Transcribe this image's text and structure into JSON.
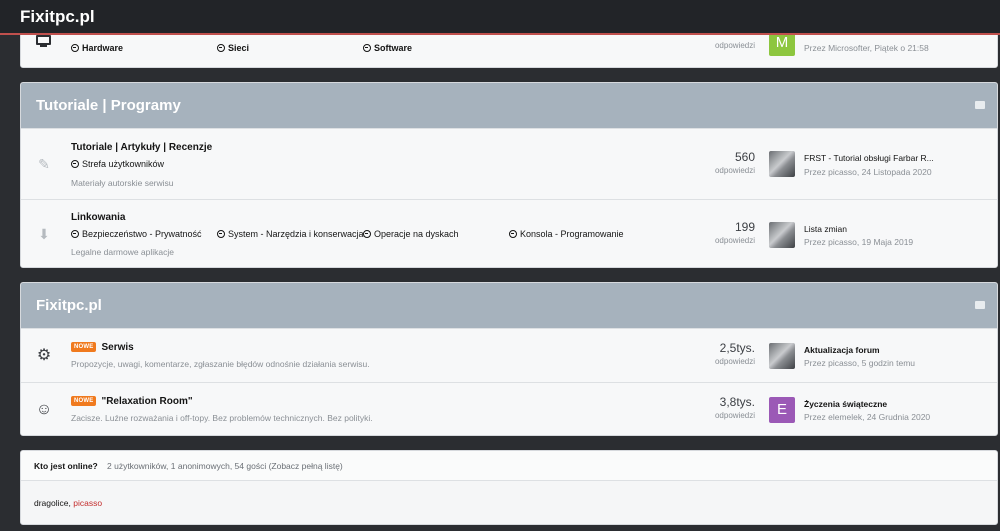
{
  "site": {
    "brand": "Fixitpc.pl"
  },
  "top_forum": {
    "sublinks": [
      "Hardware",
      "Sieci",
      "Software"
    ],
    "stat_label": "odpowiedzi",
    "last_author_line": "Przez Microsofter, Piątek o 21:58",
    "avatar_letter": "M",
    "avatar_color": "#8dc63f"
  },
  "sections": [
    {
      "title": "Tutoriale | Programy",
      "forums": [
        {
          "title": "Tutoriale | Artykuły | Recenzje",
          "sublinks": [
            "Strefa użytkowników"
          ],
          "description": "Materiały autorskie serwisu",
          "count": "560",
          "count_label": "odpowiedzi",
          "last_title": "FRST - Tutorial obsługi Farbar R...",
          "last_meta": "Przez picasso, 24 Listopada 2020"
        },
        {
          "title": "Linkowania",
          "sublinks": [
            "Bezpieczeństwo - Prywatność",
            "System - Narzędzia i konserwacja",
            "Operacje na dyskach",
            "Konsola - Programowanie"
          ],
          "description": "Legalne darmowe aplikacje",
          "count": "199",
          "count_label": "odpowiedzi",
          "last_title": "Lista zmian",
          "last_meta": "Przez picasso, 19 Maja 2019"
        }
      ]
    },
    {
      "title": "Fixitpc.pl",
      "forums": [
        {
          "badge": "NOWE",
          "title": "Serwis",
          "description": "Propozycje, uwagi, komentarze, zgłaszanie błędów odnośnie działania serwisu.",
          "count": "2,5tys.",
          "count_label": "odpowiedzi",
          "last_title": "Aktualizacja forum",
          "last_meta": "Przez picasso, 5 godzin temu"
        },
        {
          "badge": "NOWE",
          "title": "\"Relaxation Room\"",
          "description": "Zacisze. Luźne rozważania i off-topy. Bez problemów technicznych. Bez polityki.",
          "count": "3,8tys.",
          "count_label": "odpowiedzi",
          "last_title": "Życzenia świąteczne",
          "last_meta": "Przez elemelek, 24 Grudnia 2020",
          "avatar_letter": "E",
          "avatar_color": "#9b59b6"
        }
      ]
    }
  ],
  "online": {
    "label": "Kto jest online?",
    "detail": "2 użytkowników, 1 anonimowych, 54 gości (Zobacz pełną listę)",
    "user1": "dragolice",
    "separator": ", ",
    "user2": "picasso"
  },
  "colors": {
    "accent": "#c0504d",
    "category_header": "#a6b2bd",
    "badge": "#f07a1e",
    "moderator": "#c42c2c"
  }
}
